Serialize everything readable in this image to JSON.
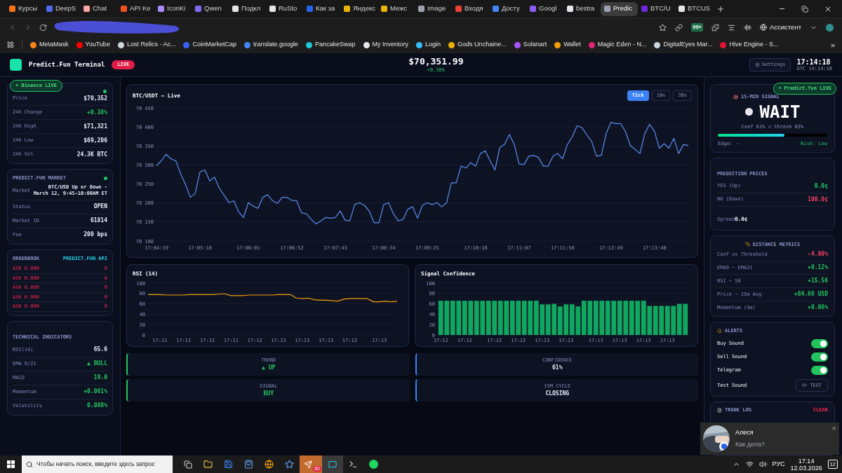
{
  "browser": {
    "tabs": [
      {
        "label": "Курсы",
        "color": "#f97316",
        "selected": false
      },
      {
        "label": "DeepS",
        "color": "#4f6bed",
        "selected": false
      },
      {
        "label": "Chat",
        "color": "#fca5a5",
        "selected": false
      },
      {
        "label": "API Ke",
        "color": "#f4511e",
        "selected": false
      },
      {
        "label": "IconKi",
        "color": "#a78bfa",
        "selected": false
      },
      {
        "label": "Qwen",
        "color": "#7c6cf2",
        "selected": false
      },
      {
        "label": "Подкл",
        "color": "#e5e5e5",
        "selected": false
      },
      {
        "label": "RuSto",
        "color": "#e5e5e5",
        "selected": false
      },
      {
        "label": "Как за",
        "color": "#2563eb",
        "selected": false
      },
      {
        "label": "Яндекс",
        "color": "#eab308",
        "selected": false
      },
      {
        "label": "Межс",
        "color": "#eab308",
        "selected": false
      },
      {
        "label": "Image",
        "color": "#9ca3af",
        "selected": false
      },
      {
        "label": "Входя",
        "color": "#ea4335",
        "selected": false
      },
      {
        "label": "Досту",
        "color": "#4285f4",
        "selected": false
      },
      {
        "label": "Googl",
        "color": "#8b5cf6",
        "selected": false
      },
      {
        "label": "bestra",
        "color": "#e5e7eb",
        "selected": false
      },
      {
        "label": "Predic",
        "color": "#9ca3af",
        "selected": true
      },
      {
        "label": "BTC/U",
        "color": "#6d28d9",
        "selected": false
      },
      {
        "label": "BTCUS",
        "color": "#e5e5e5",
        "selected": false
      }
    ],
    "badge": "99+",
    "assistant": "Ассистент",
    "bookmarks": [
      {
        "label": "MetaMask",
        "color": "#f6851b"
      },
      {
        "label": "YouTube",
        "color": "#ff0000"
      },
      {
        "label": "Lost Relics - Ac...",
        "color": "#d1d5db"
      },
      {
        "label": "CoinMarketCap",
        "color": "#3861fb"
      },
      {
        "label": "translate.google",
        "color": "#4285f4"
      },
      {
        "label": "PancakeSwap",
        "color": "#1fc7d4"
      },
      {
        "label": "My Inventory",
        "color": "#e5e7eb"
      },
      {
        "label": "Login",
        "color": "#38bdf8"
      },
      {
        "label": "Gods Unchaine...",
        "color": "#eab308"
      },
      {
        "label": "Solanart",
        "color": "#a855f7"
      },
      {
        "label": "Wallet",
        "color": "#f59e0b"
      },
      {
        "label": "Magic Eden - N...",
        "color": "#e42575"
      },
      {
        "label": "DigitalEyes Mar...",
        "color": "#cbd5e1"
      },
      {
        "label": "Hive Engine - S...",
        "color": "#e31337"
      }
    ],
    "more": "»"
  },
  "app": {
    "title": "Predict.Fun Terminal",
    "live": "LIVE",
    "price": "$70,351.99",
    "change": "+0.38%",
    "settings": "Settings",
    "time": "17:14:18",
    "utc": "UTC 14:14:18",
    "binance_badge": "• Binance LIVE",
    "ticker": {
      "rows": [
        {
          "label": "Price",
          "value": "$70,352",
          "kind": "plain"
        },
        {
          "label": "24h Change",
          "value": "+0.38%",
          "kind": "up"
        },
        {
          "label": "24h High",
          "value": "$71,321",
          "kind": "plain"
        },
        {
          "label": "24h Low",
          "value": "$69,206",
          "kind": "plain"
        },
        {
          "label": "24h Vol",
          "value": "24.3K BTC",
          "kind": "plain"
        }
      ]
    },
    "market": {
      "title": "PREDICT.FUN MARKET",
      "rows": [
        {
          "label": "Market",
          "value": "BTC/USD Up or Down - March 12, 9:45-10:00AM ET",
          "kind": "multiline"
        },
        {
          "label": "Status",
          "value": "OPEN",
          "kind": "plain"
        },
        {
          "label": "Market ID",
          "value": "61814",
          "kind": "plain"
        },
        {
          "label": "Fee",
          "value": "200 bps",
          "kind": "plain"
        }
      ]
    },
    "orderbook": {
      "title": "ORDERBOOK",
      "source": "PREDICT.FUN API",
      "rows": [
        {
          "side": "ASK 0.000",
          "size": "0"
        },
        {
          "side": "ASK 0.000",
          "size": "0"
        },
        {
          "side": "ASK 0.000",
          "size": "0"
        },
        {
          "side": "ASK 0.000",
          "size": "0"
        },
        {
          "side": "ASK 0.000",
          "size": "0"
        }
      ]
    },
    "indicators": {
      "title": "TECHNICAL INDICATORS",
      "rows": [
        {
          "label": "RSI(14)",
          "value": "65.6",
          "kind": "plain"
        },
        {
          "label": "EMA 9/21",
          "value": "▲ BULL",
          "kind": "up"
        },
        {
          "label": "MACD",
          "value": "19.0",
          "kind": "up"
        },
        {
          "label": "Momentum",
          "value": "+0.061%",
          "kind": "up"
        },
        {
          "label": "Volatility",
          "value": "0.088%",
          "kind": "up"
        }
      ]
    },
    "price_chart": {
      "title": "BTC/USDT — Live",
      "ranges": [
        {
          "label": "Tick",
          "selected": true
        },
        {
          "label": "10s",
          "selected": false
        },
        {
          "label": "30s",
          "selected": false
        }
      ],
      "chart_data": {
        "type": "line",
        "grid": true,
        "ylim": [
          70100,
          70450
        ],
        "yticks": [
          {
            "value": 70100,
            "label": "70 100"
          },
          {
            "value": 70150,
            "label": "70 150"
          },
          {
            "value": 70200,
            "label": "70 200"
          },
          {
            "value": 70250,
            "label": "70 250"
          },
          {
            "value": 70300,
            "label": "70 300"
          },
          {
            "value": 70350,
            "label": "70 350"
          },
          {
            "value": 70400,
            "label": "70 400"
          },
          {
            "value": 70450,
            "label": "70 450"
          }
        ],
        "categories": [
          "17:04:19",
          null,
          null,
          null,
          null,
          null,
          null,
          null,
          null,
          "17:05:10",
          null,
          null,
          null,
          null,
          null,
          null,
          null,
          null,
          null,
          "17:06:01",
          null,
          null,
          null,
          null,
          null,
          null,
          null,
          null,
          "17:06:52",
          null,
          null,
          null,
          null,
          null,
          null,
          null,
          null,
          "17:07:43",
          null,
          null,
          null,
          null,
          null,
          null,
          null,
          null,
          null,
          "17:08:34",
          null,
          null,
          null,
          null,
          null,
          null,
          null,
          null,
          "17:09:25",
          null,
          null,
          null,
          null,
          null,
          null,
          null,
          null,
          null,
          "17:10:16",
          null,
          null,
          null,
          null,
          null,
          null,
          null,
          null,
          "17:11:07",
          null,
          null,
          null,
          null,
          null,
          null,
          null,
          null,
          "17:11:58",
          null,
          null,
          null,
          null,
          null,
          null,
          null,
          null,
          null,
          "17:12:49",
          null,
          null,
          null,
          null,
          null,
          null,
          null,
          null,
          "17:13:40",
          null,
          null,
          null,
          null,
          null,
          null,
          null
        ],
        "series": [
          {
            "color": "#5b8def",
            "values": [
              70298,
              70311,
              70328,
              70316,
              70311,
              70277,
              70249,
              70215,
              70225,
              70282,
              70287,
              70258,
              70268,
              70239,
              70220,
              70201,
              70206,
              70177,
              70162,
              70201,
              70192,
              70186,
              70215,
              70222,
              70206,
              70199,
              70215,
              70215,
              70207,
              70206,
              70174,
              70172,
              70157,
              70145,
              70153,
              70162,
              70160,
              70162,
              70179,
              70155,
              70153,
              70196,
              70201,
              70194,
              70179,
              70148,
              70148,
              70196,
              70201,
              70172,
              70153,
              70157,
              70184,
              70190,
              70160,
              70194,
              70201,
              70196,
              70201,
              70190,
              70201,
              70253,
              70253,
              70297,
              70292,
              70306,
              70297,
              70330,
              70337,
              70311,
              70287,
              70346,
              70354,
              70380,
              70354,
              70303,
              70301,
              70323,
              70325,
              70320,
              70297,
              70297,
              70323,
              70330,
              70316,
              70354,
              70374,
              70403,
              70398,
              70379,
              70362,
              70323,
              70325,
              70383,
              70412,
              70409,
              70409,
              70388,
              70351,
              70341,
              70330,
              70383,
              70407,
              70388,
              70344,
              70356,
              70344,
              70370,
              70330,
              70354,
              70351
            ]
          }
        ]
      }
    },
    "rsi_chart": {
      "title": "RSI (14)",
      "chart_data": {
        "type": "line",
        "grid": true,
        "ylim": [
          0,
          100
        ],
        "yticks": [
          0,
          20,
          40,
          60,
          80,
          100
        ],
        "categories": [
          null,
          null,
          "17:11",
          null,
          null,
          null,
          "17:11",
          null,
          null,
          null,
          "17:11",
          null,
          null,
          null,
          "17:11",
          null,
          null,
          null,
          "17:12",
          null,
          null,
          null,
          "17:13",
          null,
          null,
          null,
          "17:13",
          null,
          null,
          null,
          "17:13",
          null,
          null,
          null,
          "17:13",
          null,
          null,
          null,
          null,
          "17:13",
          null,
          null,
          null
        ],
        "series": [
          {
            "color": "#f59e0b",
            "values": [
              78,
              78,
              78,
              77,
              77,
              77,
              77,
              78,
              78,
              78,
              78,
              78,
              79,
              79,
              76,
              76,
              76,
              77,
              77,
              77,
              77,
              77,
              78,
              78,
              78,
              71,
              70,
              71,
              68,
              67,
              67,
              66,
              65,
              69,
              70,
              70,
              70,
              70,
              64,
              64,
              65,
              64,
              65
            ]
          }
        ]
      }
    },
    "confidence_chart": {
      "title": "Signal Confidence",
      "chart_data": {
        "type": "bar",
        "grid": true,
        "ylim": [
          0,
          100
        ],
        "yticks": [
          0,
          20,
          40,
          60,
          80,
          100
        ],
        "categories": [
          "17:12",
          null,
          null,
          null,
          "17:12",
          null,
          null,
          null,
          null,
          "17:12",
          null,
          null,
          null,
          "17:12",
          null,
          null,
          null,
          "17:13",
          null,
          null,
          null,
          "17:13",
          null,
          null,
          null,
          null,
          "17:13",
          null,
          null,
          null,
          "17:13",
          null,
          null,
          null,
          "17:13",
          null,
          null,
          null,
          "17:13",
          null,
          null,
          null
        ],
        "series": [
          {
            "color": "#10a760",
            "values": [
              66,
              66,
              66,
              66,
              66,
              66,
              66,
              66,
              66,
              66,
              66,
              66,
              66,
              66,
              66,
              66,
              66,
              59,
              59,
              60,
              55,
              59,
              59,
              55,
              66,
              66,
              66,
              66,
              66,
              66,
              66,
              66,
              66,
              66,
              66,
              56,
              56,
              56,
              56,
              56,
              60,
              60
            ]
          }
        ]
      }
    },
    "tiles": [
      {
        "label": "TREND",
        "value": "▲ UP",
        "color": "#22c55e",
        "kind": "up"
      },
      {
        "label": "CONFIDENCE",
        "value": "61%",
        "color": "#3b82f6",
        "kind": "plain"
      },
      {
        "label": "SIGNAL",
        "value": "BUY",
        "color": "#22c55e",
        "kind": "up"
      },
      {
        "label": "15M CYCLE",
        "value": "CLOSING",
        "color": "#3b82f6",
        "kind": "plain"
      }
    ],
    "predict_badge": "• Predict.fun LIVE",
    "signal": {
      "title": "15-MIN SIGNAL",
      "value": "WAIT",
      "note": "Conf 61% < thresh 65%",
      "level": 0.61,
      "edge": "Edge: --",
      "risk": "Risk: Low"
    },
    "prices": {
      "title": "PREDICTION PRICES",
      "rows": [
        {
          "label": "YES (Up)",
          "value": "0.0¢",
          "kind": "up"
        },
        {
          "label": "NO (Down)",
          "value": "100.0¢",
          "kind": "down"
        }
      ],
      "spread_label": "Spread",
      "spread_value": "0.0¢"
    },
    "distance": {
      "title": "DISTANCE METRICS",
      "rows": [
        {
          "label": "Conf vs Threshold",
          "value": "-4.00%",
          "kind": "down"
        },
        {
          "label": "EMA9 − EMA21",
          "value": "+0.12%",
          "kind": "up"
        },
        {
          "label": "RSI − 50",
          "value": "+15.56",
          "kind": "up"
        },
        {
          "label": "Price − 15m Avg",
          "value": "+84.68 USD",
          "kind": "up"
        },
        {
          "label": "Momentum (5m)",
          "value": "+0.06%",
          "kind": "up"
        }
      ]
    },
    "alerts": {
      "title": "ALERTS",
      "items": [
        {
          "label": "Buy Sound",
          "on": true
        },
        {
          "label": "Sell Sound",
          "on": true
        },
        {
          "label": "Telegram",
          "on": true
        }
      ],
      "test_label": "Test Sound",
      "test_button": "TEST"
    },
    "trade_log": {
      "title": "TRADE LOG",
      "clear": "CLEAR"
    }
  },
  "toast": {
    "name": "Алеся",
    "message": "Как дела?",
    "close": "×"
  },
  "taskbar": {
    "search": "Чтобы начать поиск, введите здесь запрос",
    "telegram_badge": "60",
    "lang": "РУС",
    "time": "17:14",
    "date": "12.03.2026",
    "notifications": "12"
  }
}
